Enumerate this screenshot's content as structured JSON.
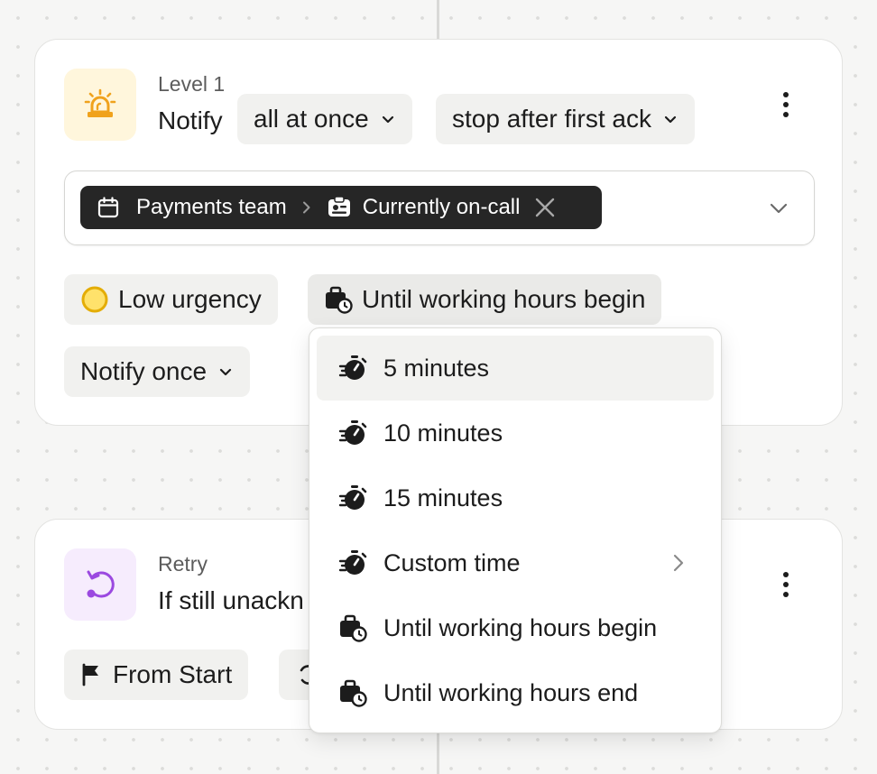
{
  "colors": {
    "background": "#f6f6f5",
    "card": "#ffffff",
    "chip_dark": "#262626",
    "urgency_low": "#f2c318",
    "level_icon": "#f0a21c",
    "retry_icon": "#9b49e0"
  },
  "level": {
    "icon": "siren-icon",
    "label": "Level 1",
    "notify_prefix": "Notify",
    "notify_mode": "all at once",
    "stop_mode": "stop after first ack",
    "targets": {
      "schedule_icon": "calendar-icon",
      "team": "Payments team",
      "separator_icon": "chevron-right-icon",
      "oncall_icon": "id-badge-icon",
      "target": "Currently on-call",
      "remove_icon": "close-icon"
    },
    "urgency": "Low urgency",
    "delay": "Until working hours begin",
    "repeat": "Notify once"
  },
  "delay_menu": {
    "items": [
      {
        "icon": "stopwatch-icon",
        "label": "5 minutes",
        "active": true
      },
      {
        "icon": "stopwatch-icon",
        "label": "10 minutes"
      },
      {
        "icon": "stopwatch-icon",
        "label": "15 minutes"
      },
      {
        "icon": "stopwatch-icon",
        "label": "Custom time",
        "has_submenu": true
      },
      {
        "icon": "briefcase-clock-icon",
        "label": "Until working hours begin"
      },
      {
        "icon": "briefcase-clock-icon",
        "label": "Until working hours end"
      }
    ]
  },
  "retry": {
    "icon": "retry-icon",
    "label": "Retry",
    "condition": "If still unackn",
    "from_button": "From Start"
  }
}
